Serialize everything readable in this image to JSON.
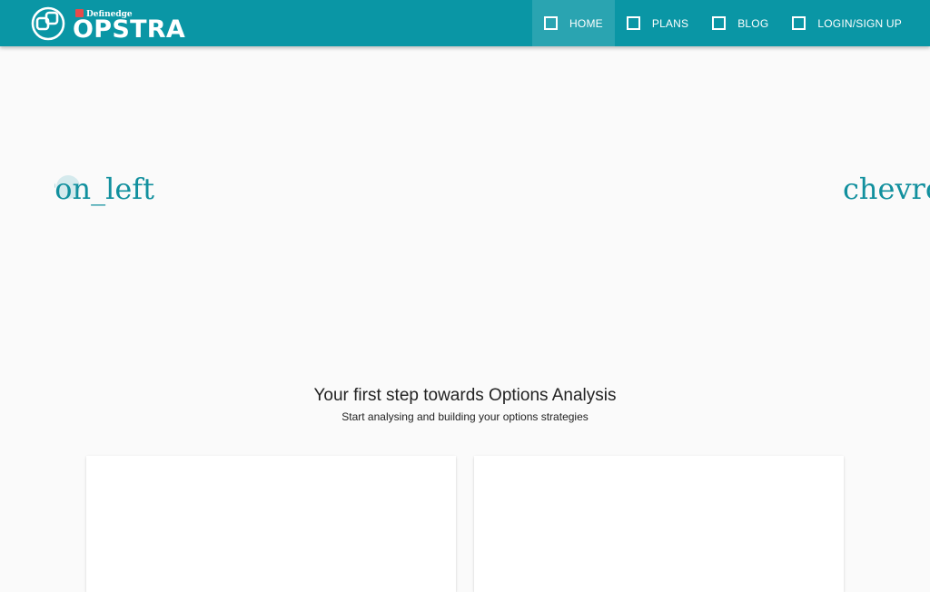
{
  "header": {
    "brand_sub": "Definedge",
    "brand_name": "OPSTRA",
    "logo_icon": "opstra-logo-icon"
  },
  "nav": {
    "items": [
      {
        "label": "HOME",
        "icon": "checkbox-icon",
        "active": true
      },
      {
        "label": "PLANS",
        "icon": "checkbox-icon",
        "active": false
      },
      {
        "label": "BLOG",
        "icon": "checkbox-icon",
        "active": false
      },
      {
        "label": "LOGIN/SIGN UP",
        "icon": "checkbox-icon",
        "active": false
      }
    ]
  },
  "carousel": {
    "prev_text": "chevron_left",
    "next_text": "chevron_right"
  },
  "hero": {
    "title": "Your first step towards Options Analysis",
    "subtitle": "Start analysing and building your options strategies"
  },
  "colors": {
    "brand": "#0a96a5",
    "nav_active": "#2aa4b1",
    "chevron": "#12909e",
    "background": "#fafafa"
  }
}
